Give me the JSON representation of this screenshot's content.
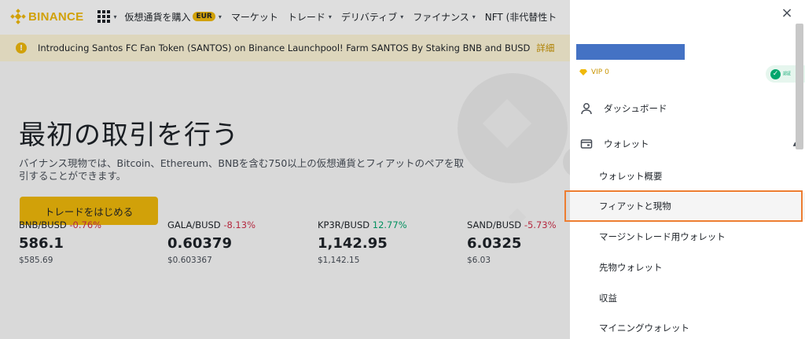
{
  "header": {
    "logo_text": "BINANCE",
    "nav": [
      {
        "label": "仮想通貨を購入",
        "badge": "EUR",
        "dropdown": "▾"
      },
      {
        "label": "マーケット",
        "dropdown": ""
      },
      {
        "label": "トレード",
        "dropdown": "▾"
      },
      {
        "label": "デリバティブ",
        "dropdown": "▾"
      },
      {
        "label": "ファイナンス",
        "dropdown": "▾"
      },
      {
        "label": "NFT (非代替性ト",
        "dropdown": ""
      }
    ],
    "apps_caret": "▾"
  },
  "announcement": {
    "icon": "!",
    "text": "Introducing Santos FC Fan Token (SANTOS) on Binance Launchpool! Farm SANTOS By Staking BNB and BUSD",
    "link": "詳細"
  },
  "hero": {
    "title": "最初の取引を行う",
    "subtitle": "バイナンス現物では、Bitcoin、Ethereum、BNBを含む750以上の仮想通貨とフィアットのペアを取引することができます。",
    "cta": "トレードをはじめる"
  },
  "tickers": [
    {
      "pair": "BNB/BUSD",
      "change": "-0.76%",
      "direction": "neg",
      "price": "586.1",
      "usd": "$585.69"
    },
    {
      "pair": "GALA/BUSD",
      "change": "-8.13%",
      "direction": "neg",
      "price": "0.60379",
      "usd": "$0.603367"
    },
    {
      "pair": "KP3R/BUSD",
      "change": "12.77%",
      "direction": "pos",
      "price": "1,142.95",
      "usd": "$1,142.15"
    },
    {
      "pair": "SAND/BUSD",
      "change": "-5.73%",
      "direction": "neg",
      "price": "6.0325",
      "usd": "$6.03"
    }
  ],
  "drawer": {
    "close": "×",
    "vip": "VIP 0",
    "verified_label": "認証",
    "dashboard": "ダッシュボード",
    "wallet": "ウォレット",
    "wallet_caret": "▲",
    "wallet_items": [
      "ウォレット概要",
      "フィアットと現物",
      "マージントレード用ウォレット",
      "先物ウォレット",
      "収益",
      "マイニングウォレット"
    ]
  },
  "colors": {
    "brand": "#f0b90b",
    "negative": "#cf304a",
    "positive": "#03a66d",
    "highlight_box": "#ed7d31",
    "redaction": "#4472c4"
  }
}
